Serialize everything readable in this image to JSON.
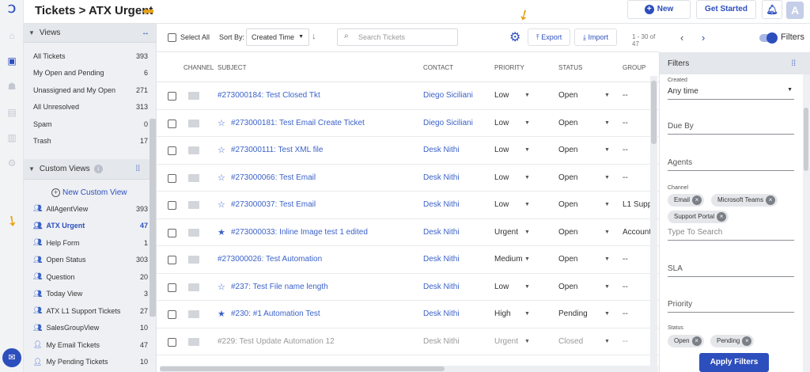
{
  "header": {
    "title": "Tickets > ATX Urgent",
    "new_label": "New",
    "get_started_label": "Get Started",
    "avatar_letter": "A"
  },
  "sidebar": {
    "views_title": "Views",
    "views": [
      {
        "label": "All Tickets",
        "count": "393"
      },
      {
        "label": "My Open and Pending",
        "count": "6"
      },
      {
        "label": "Unassigned and My Open",
        "count": "271"
      },
      {
        "label": "All Unresolved",
        "count": "313"
      },
      {
        "label": "Spam",
        "count": "0"
      },
      {
        "label": "Trash",
        "count": "17"
      }
    ],
    "custom_title": "Custom Views",
    "new_custom_view": "New Custom View",
    "custom_views": [
      {
        "label": "AllAgentView",
        "count": "393"
      },
      {
        "label": "ATX Urgent",
        "count": "47"
      },
      {
        "label": "Help Form",
        "count": "1"
      },
      {
        "label": "Open Status",
        "count": "303"
      },
      {
        "label": "Question",
        "count": "20"
      },
      {
        "label": "Today View",
        "count": "3"
      },
      {
        "label": "ATX L1 Support Tickets",
        "count": "27"
      },
      {
        "label": "SalesGroupView",
        "count": "10"
      },
      {
        "label": "My Email Tickets",
        "count": "47"
      },
      {
        "label": "My Pending Tickets",
        "count": "10"
      }
    ]
  },
  "toolbar": {
    "select_all": "Select All",
    "sort_by": "Sort By:",
    "sort_value": "Created Time",
    "search_placeholder": "Search Tickets",
    "export_label": "Export",
    "import_label": "Import",
    "pagination": "1 - 30 of 47",
    "filters_label": "Filters"
  },
  "table": {
    "headers": {
      "channel": "CHANNEL",
      "subject": "SUBJECT",
      "contact": "CONTACT",
      "priority": "PRIORITY",
      "status": "STATUS",
      "group": "GROUP"
    },
    "rows": [
      {
        "subject": "#273000184: Test Closed Tkt",
        "star": "",
        "contact": "Diego Siciliani",
        "priority": "Low",
        "status": "Open",
        "group": "--"
      },
      {
        "subject": "#273000181: Test Email Create Ticket",
        "star": "☆",
        "contact": "Diego Siciliani",
        "priority": "Low",
        "status": "Open",
        "group": "--"
      },
      {
        "subject": "#273000111: Test XML file",
        "star": "☆",
        "contact": "Desk Nithi",
        "priority": "Low",
        "status": "Open",
        "group": "--"
      },
      {
        "subject": "#273000066: Test Email",
        "star": "☆",
        "contact": "Desk Nithi",
        "priority": "Low",
        "status": "Open",
        "group": "--"
      },
      {
        "subject": "#273000037: Test Email",
        "star": "☆",
        "contact": "Desk Nithi",
        "priority": "Low",
        "status": "Open",
        "group": "L1 Supp"
      },
      {
        "subject": "#273000033: Inline Image test 1 edited",
        "star": "★",
        "contact": "Desk Nithi",
        "priority": "Urgent",
        "status": "Open",
        "group": "Account"
      },
      {
        "subject": "#273000026: Test Automation",
        "star": "",
        "contact": "Desk Nithi",
        "priority": "Medium",
        "status": "Open",
        "group": "--"
      },
      {
        "subject": "#237: Test File name length",
        "star": "☆",
        "contact": "Desk Nithi",
        "priority": "Low",
        "status": "Open",
        "group": "--"
      },
      {
        "subject": "#230: #1 Automation Test",
        "star": "★",
        "contact": "Desk Nithi",
        "priority": "High",
        "status": "Pending",
        "group": "--"
      },
      {
        "subject": "#229: Test Update Automation 12",
        "star": "",
        "contact": "Desk Nithi",
        "priority": "Urgent",
        "status": "Closed",
        "group": "--"
      }
    ]
  },
  "filters": {
    "title": "Filters",
    "created_label": "Created",
    "created_value": "Any time",
    "due_by": "Due By",
    "agents": "Agents",
    "channel_label": "Channel",
    "channel_chips": [
      "Email",
      "Microsoft Teams",
      "Support Portal"
    ],
    "channel_placeholder": "Type To Search",
    "sla": "SLA",
    "priority": "Priority",
    "status_label": "Status",
    "status_chips": [
      "Open",
      "Pending"
    ],
    "apply_label": "Apply Filters"
  },
  "colors": {
    "accent": "#2d4fbd",
    "link": "#3b62c9",
    "arrow": "#e8a317"
  }
}
